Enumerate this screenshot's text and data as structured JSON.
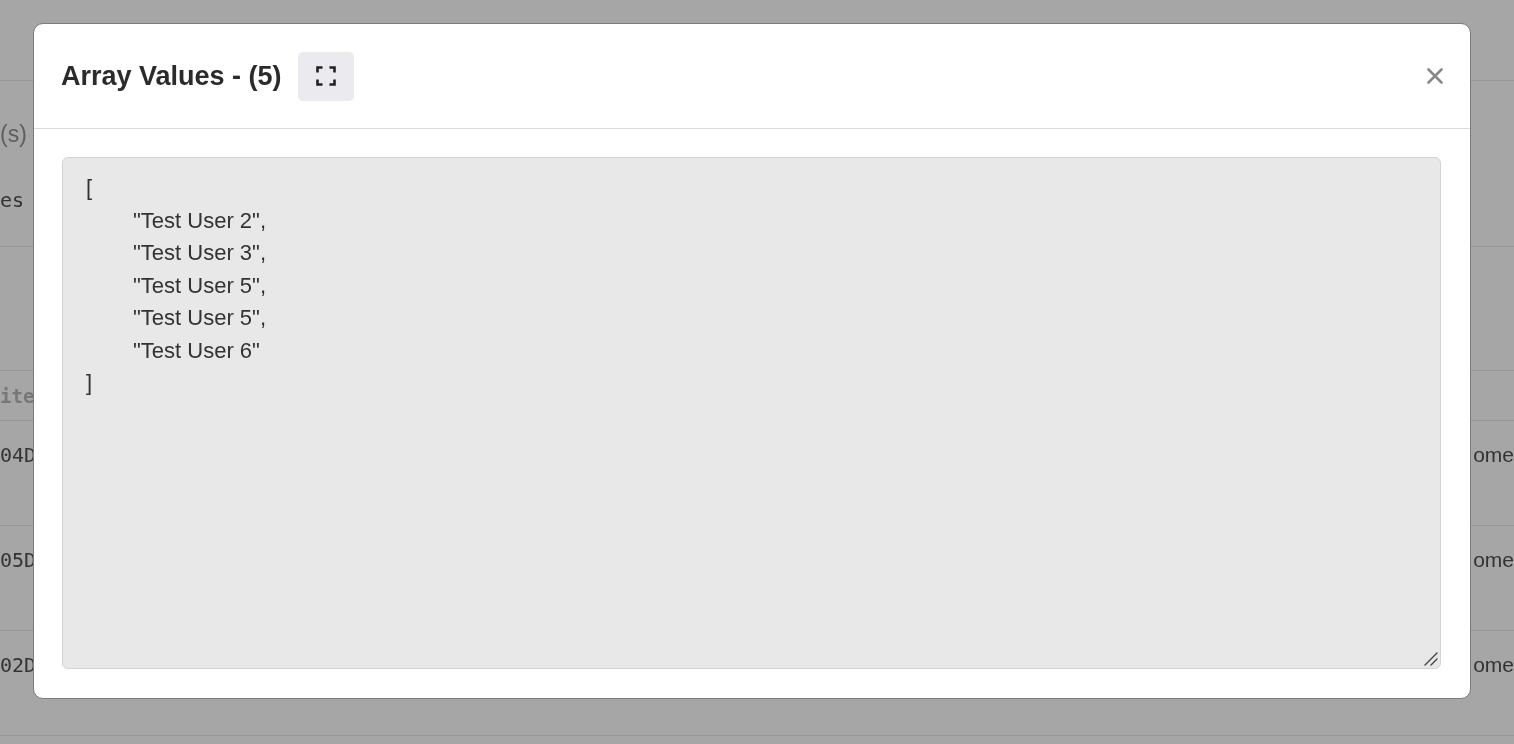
{
  "background_page": {
    "heading_fragment": "(s)",
    "label_fragment": "es",
    "table": {
      "header": "ite",
      "rows": [
        {
          "column_1": "04D",
          "column_2": "ome"
        },
        {
          "column_1": "05D",
          "column_2": "ome"
        },
        {
          "column_1": "02D",
          "column_2": "ome"
        }
      ]
    }
  },
  "dialog": {
    "title": "Array Values - (5)",
    "value": "[\n\t\"Test User 2\",\n\t\"Test User 3\",\n\t\"Test User 5\",\n\t\"Test User 5\",\n\t\"Test User 6\"\n]"
  }
}
